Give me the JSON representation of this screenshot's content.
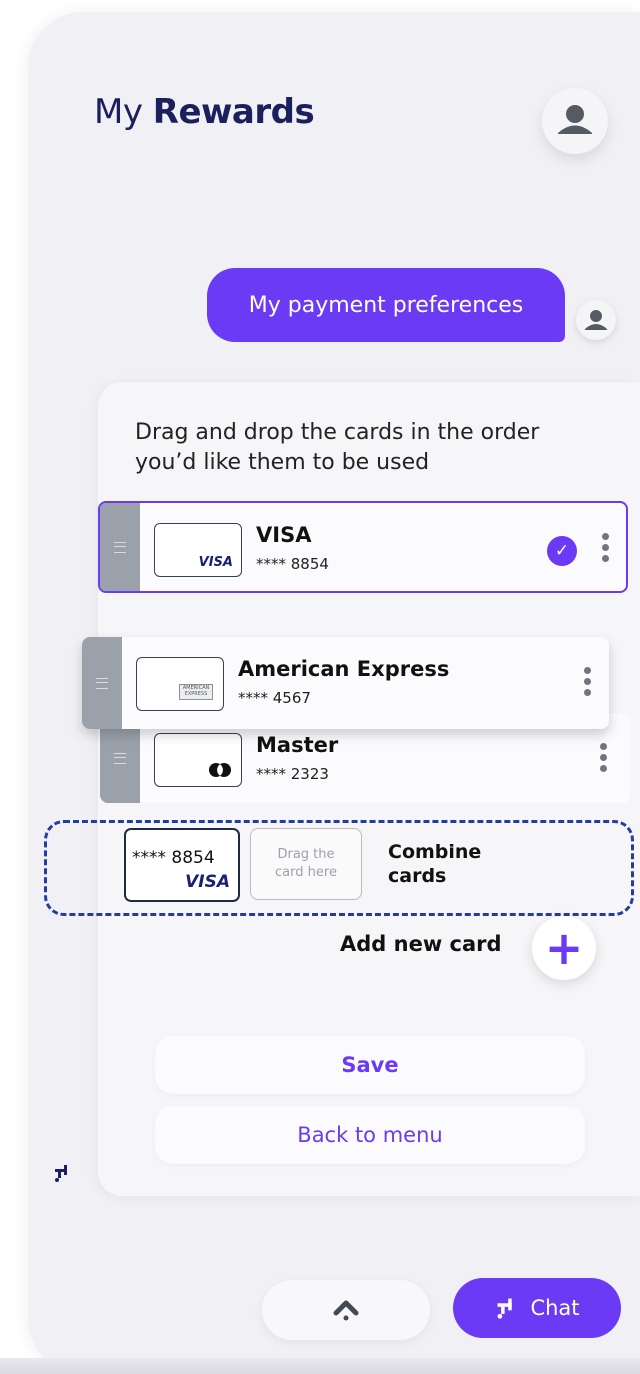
{
  "header": {
    "title_part1": "My",
    "title_part2": "Rewards"
  },
  "chat": {
    "user_message": "My payment preferences",
    "instruction": "Drag and drop the cards in the order you’d like them to be used"
  },
  "cards": [
    {
      "name": "VISA",
      "number": "**** 8854",
      "thumb_label": "VISA",
      "selected": true
    },
    {
      "name": "American Express",
      "number": "**** 4567",
      "thumb_label": "AMERICAN EXPRESS"
    },
    {
      "name": "Master",
      "number": "**** 2323"
    }
  ],
  "combine": {
    "card_number": "**** 8854",
    "card_brand": "VISA",
    "drop_hint": "Drag the card here",
    "label": "Combine cards"
  },
  "actions": {
    "add_card": "Add new card",
    "save": "Save",
    "back": "Back to menu",
    "chat": "Chat"
  },
  "colors": {
    "accent": "#6a3af5",
    "title": "#1c1f5e",
    "dashed_border": "#233ba3",
    "handle": "#9aa1ab"
  }
}
